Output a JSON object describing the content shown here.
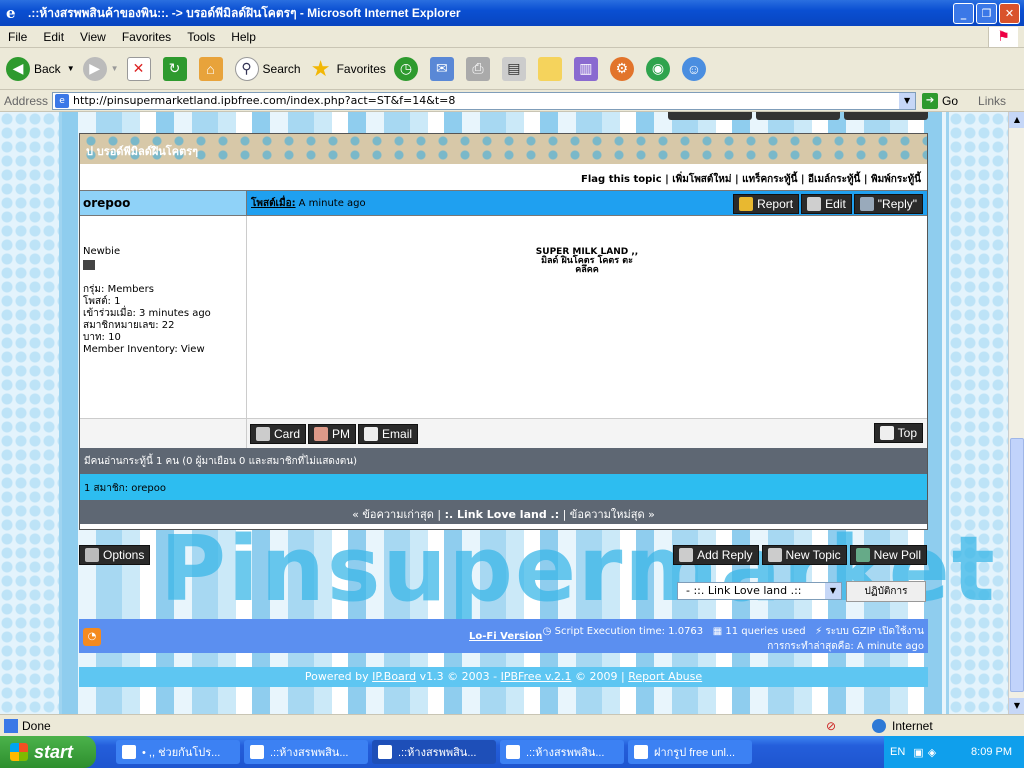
{
  "window": {
    "title": ".::ห้างสรพพสินค้าของพิน::. -> บรอด์พีมิลด์ฝินโคตรๆ - Microsoft Internet Explorer"
  },
  "menu": [
    "File",
    "Edit",
    "View",
    "Favorites",
    "Tools",
    "Help"
  ],
  "toolbar": {
    "back": "Back",
    "search": "Search",
    "favorites": "Favorites"
  },
  "address": {
    "label": "Address",
    "url": "http://pinsupermarketland.ipbfree.com/index.php?act=ST&f=14&t=8",
    "go": "Go",
    "links": "Links"
  },
  "page": {
    "header_title": "ป บรอด์พีมิลด์ฝินโคตรๆ",
    "topic_actions": "Flag this topic | เพิ่มโพสต์ใหม่ | แทร็คกระทู้นี้ | อีเมล์กระทู้นี้ | พิมพ์กระทู้นี้",
    "post": {
      "author": "orepoo",
      "posted_label": "โพสต์เมื่อ:",
      "posted_time": "A minute ago",
      "btn_report": "Report",
      "btn_edit": "Edit",
      "btn_reply": "\"Reply\"",
      "rank": "Newbie",
      "group": "กรุ่ม: Members",
      "posts": "โพสต์: 1",
      "joined": "เข้าร่วมเมื่อ: 3 minutes ago",
      "member_no": "สมาชิกหมายเลข: 22",
      "money": "บาท: 10",
      "inventory": "Member Inventory: View",
      "body_title": "SUPER MILK LAND ,,",
      "body_line1": "มิลด์ ฝินโคตร โคตร ตะ",
      "body_line2": "คลึคค",
      "btn_card": "Card",
      "btn_pm": "PM",
      "btn_email": "Email",
      "btn_top": "Top"
    },
    "online_stats": "มีคนอ่านกระทู้นี้ 1 คน (0 ผู้มาเยือน 0 และสมาชิกที่ไม่แสดงตน)",
    "online_members": "1 สมาชิก: orepoo",
    "nav_prev": "« ข้อความเก่าสุด |",
    "nav_forum": ":. Link Love land .:",
    "nav_next": "| ข้อความใหม่สุด »",
    "btn_options": "Options",
    "btn_add_reply": "Add Reply",
    "btn_new_topic": "New Topic",
    "btn_new_poll": "New Poll",
    "jump_select": "- ::. Link Love land .::",
    "jump_go": "ปฏิบัติการ",
    "lofi": "Lo-Fi Version",
    "exec_time": "Script Execution time: 1.0763",
    "queries": "11 queries used",
    "gzip": "ระบบ GZIP เปิดใช้งาน",
    "last_action": "การกระทำล่าสุดคือ: A minute ago",
    "powered_prefix": "Powered by",
    "powered_ipb": "IP.Board",
    "powered_mid": "v1.3 © 2003 -",
    "powered_ipbfree": "IPBFree v.2.1",
    "powered_year": "© 2009 |",
    "report_abuse": "Report Abuse",
    "watermark": "Pinsupermarket"
  },
  "status": {
    "text": "Done",
    "zone": "Internet"
  },
  "taskbar": {
    "start": "start",
    "tasks": [
      "• ,, ช่วยกันโปร...",
      ".::ห้างสรพพสิน...",
      ".::ห้างสรพพสิน...",
      ".::ห้างสรพพสิน...",
      "ฝากรูป free unl..."
    ],
    "lang": "EN",
    "clock": "8:09 PM"
  }
}
